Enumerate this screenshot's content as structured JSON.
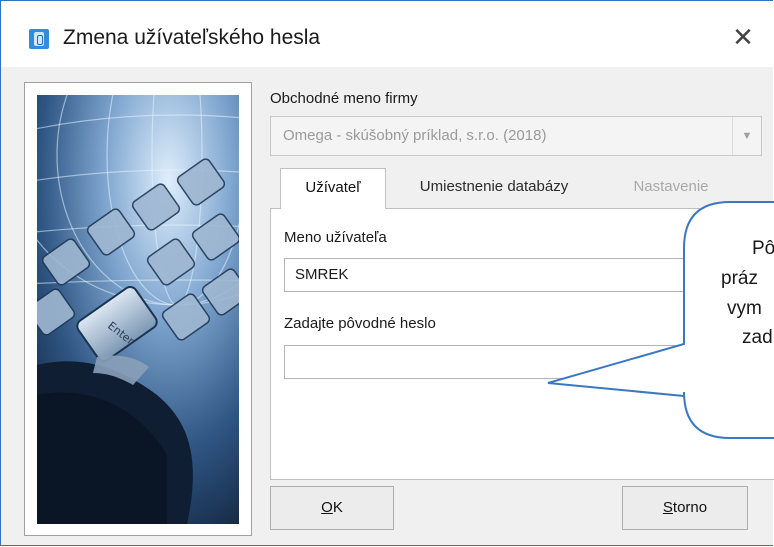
{
  "window": {
    "title": "Zmena užívateľského hesla",
    "close_glyph": "✕"
  },
  "company": {
    "label": "Obchodné meno firmy",
    "value": "Omega - skúšobný príklad, s.r.o. (2018)",
    "arrow_glyph": "▼"
  },
  "tabs": [
    {
      "label": "Užívateľ",
      "state": "active"
    },
    {
      "label": "Umiestnenie databázy",
      "state": "normal"
    },
    {
      "label": "Nastavenie",
      "state": "disabled"
    }
  ],
  "user": {
    "label": "Meno užívateľa",
    "value": "SMREK"
  },
  "password": {
    "label": "Zadajte pôvodné heslo",
    "value": ""
  },
  "buttons": {
    "ok_mnemonic": "O",
    "ok_rest": "K",
    "cancel_mnemonic": "S",
    "cancel_rest": "torno"
  },
  "callout": {
    "lines": [
      "Pô",
      "práz",
      "vym",
      "zad"
    ]
  },
  "icons": {
    "app": "omega-app-icon",
    "close": "close-icon",
    "dropdown": "chevron-down-icon"
  },
  "colors": {
    "window_border": "#2f74c0",
    "app_icon": "#2d8fd9",
    "callout_stroke": "#3a78c4",
    "disabled_text": "#a9a9a9"
  }
}
